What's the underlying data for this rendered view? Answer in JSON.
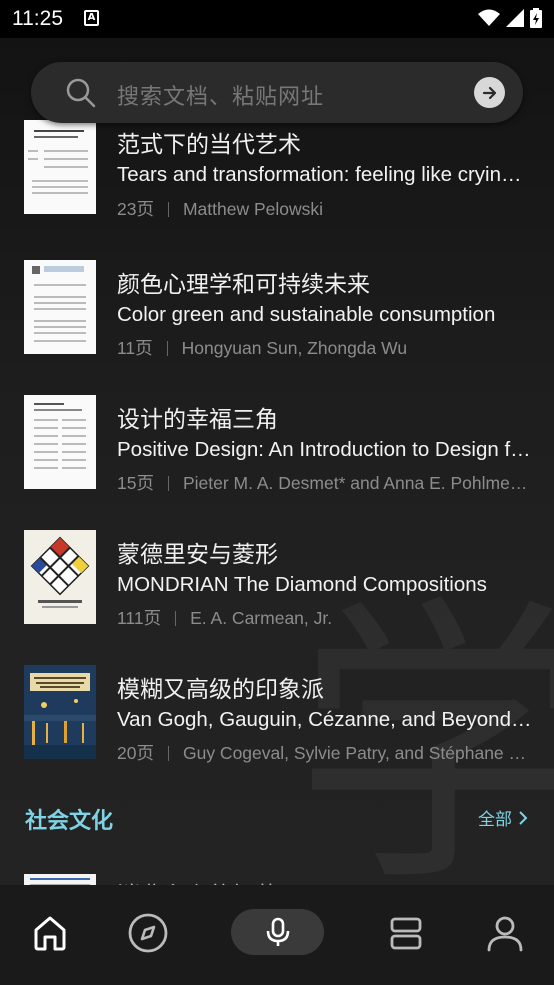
{
  "status_bar": {
    "time": "11:25",
    "notification_icon": "A"
  },
  "search": {
    "placeholder": "搜索文档、粘贴网址"
  },
  "documents": [
    {
      "title_cn": "范式下的当代艺术",
      "title_en": "Tears and transformation: feeling like crying as an indicator of insightful or \"aesthetic\" experience with art",
      "pages": "23页",
      "authors": "Matthew Pelowski"
    },
    {
      "title_cn": "颜色心理学和可持续未来",
      "title_en": "Color green and sustainable consumption",
      "pages": "11页",
      "authors": "Hongyuan Sun, Zhongda Wu"
    },
    {
      "title_cn": "设计的幸福三角",
      "title_en": "Positive Design: An Introduction to Design for Subjective Well-Being",
      "pages": "15页",
      "authors": "Pieter M. A. Desmet* and Anna E. Pohlmeyer"
    },
    {
      "title_cn": "蒙德里安与菱形",
      "title_en": "MONDRIAN The Diamond Compositions",
      "pages": "111页",
      "authors": "E. A. Carmean, Jr."
    },
    {
      "title_cn": "模糊又高级的印象派",
      "title_en": "Van Gogh, Gauguin, Cézanne, and Beyond: Post-Impressionist Masterpieces",
      "pages": "20页",
      "authors": "Guy Cogeval, Sylvie Patry, and Stéphane Guégan"
    }
  ],
  "section": {
    "title": "社会文化",
    "all_label": "全部"
  },
  "peek": {
    "title_cn": "消费主义的解药"
  },
  "nav": [
    "home-icon",
    "compass-icon",
    "mic-icon",
    "library-icon",
    "profile-icon"
  ]
}
